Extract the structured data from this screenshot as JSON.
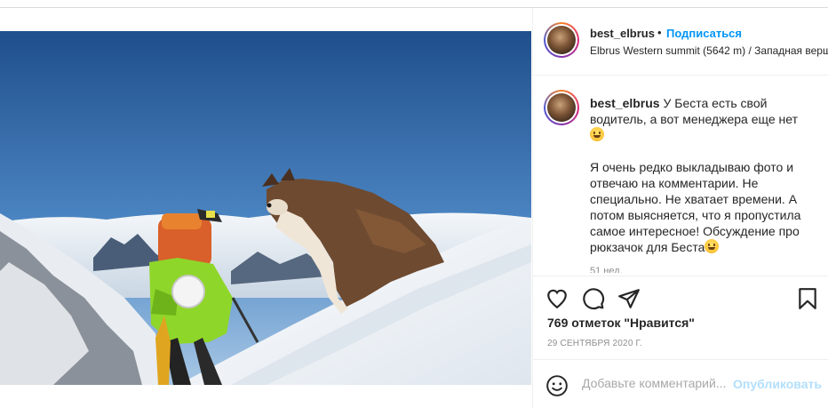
{
  "post": {
    "username": "best_elbrus",
    "separator": "•",
    "follow_label": "Подписаться",
    "location": "Elbrus Western summit (5642 m) / Западная верши",
    "caption": {
      "username": "best_elbrus",
      "line1": "У Беста есть свой водитель, а вот менеджера еще нет",
      "paragraph2": "Я очень редко выкладываю фото и отвечаю на комментарии. Не специально. Не хватает времени. А потом выясняется, что я пропустила самое интересное! Обсуждение про рюкзачок для Беста"
    },
    "caption_time": "51 нед.",
    "likes_text": "769 отметок \"Нравится\"",
    "date": "29 СЕНТЯБРЯ 2020 Г.",
    "comment_placeholder": "Добавьте комментарий...",
    "publish_label": "Опубликовать"
  },
  "icons": {
    "like": "heart-icon",
    "comment": "comment-bubble-icon",
    "share": "paper-plane-icon",
    "save": "bookmark-icon",
    "emoji": "smiley-icon"
  },
  "colors": {
    "link_blue": "#0095f6",
    "publish_disabled": "#b2dffc",
    "text": "#262626",
    "muted": "#8e8e8e"
  }
}
